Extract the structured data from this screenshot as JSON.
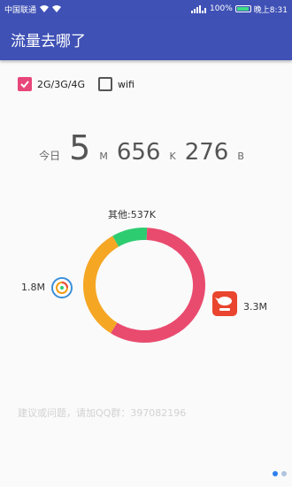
{
  "status_bar": {
    "carrier": "中国联通",
    "battery": "100%",
    "time": "晚上8:31"
  },
  "app_bar": {
    "title": "流量去哪了"
  },
  "filters": [
    {
      "label": "2G/3G/4G",
      "checked": true
    },
    {
      "label": "wifi",
      "checked": false
    }
  ],
  "today": {
    "label": "今日",
    "mb": "5",
    "mb_unit": "M",
    "kb": "656",
    "kb_unit": "K",
    "b": "276",
    "b_unit": "B"
  },
  "chart_data": {
    "type": "pie",
    "style": "donut",
    "slices": [
      {
        "label": "其他:537K",
        "value": 0.537,
        "color": "#2ecc71"
      },
      {
        "label": "3.3M",
        "value": 3.3,
        "color": "#e94b6f",
        "icon": "red-app-icon"
      },
      {
        "label": "1.8M",
        "value": 1.8,
        "color": "#f5a623",
        "icon": "tencent-news-icon"
      }
    ]
  },
  "footer": {
    "text": "建议或问题，请加QQ群：397082196"
  },
  "pager": {
    "pages": 2,
    "current": 0
  },
  "colors": {
    "primary": "#3f51b5",
    "accent": "#e8467a"
  }
}
